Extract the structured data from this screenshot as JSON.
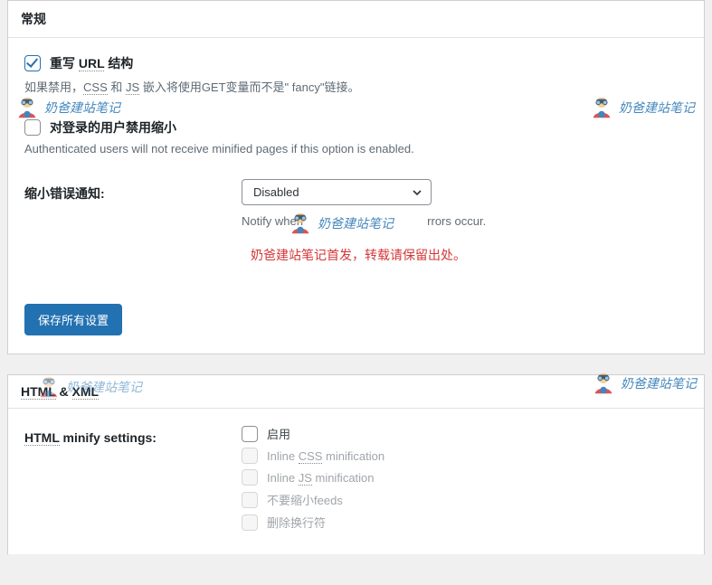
{
  "general": {
    "title": "常规",
    "rewrite": {
      "label_pre": "重写",
      "label_url": "URL",
      "label_post": "结构",
      "checked": true,
      "desc_pre": "如果禁用，",
      "desc_css": "CSS",
      "desc_mid1": "和",
      "desc_js": "JS",
      "desc_post": "嵌入将使用GET变量而不是\" fancy\"链接。"
    },
    "disable_loggedin": {
      "label": "对登录的用户禁用缩小",
      "checked": false,
      "desc": "Authenticated users will not receive minified pages if this option is enabled."
    },
    "error_notify": {
      "label": "缩小错误通知:",
      "selected": "Disabled",
      "desc_pre": "Notify when ",
      "desc_post": "rrors occur."
    },
    "attribution": "奶爸建站笔记首发，转载请保留出处。",
    "save_button": "保存所有设置"
  },
  "htmlxml": {
    "title_pre": "HTML",
    "title_mid": " & ",
    "title_post": "XML",
    "minify_label_pre": "HTML",
    "minify_label_post": " minify settings:",
    "options": {
      "enable": {
        "label": "启用",
        "enabled": true,
        "checked": false
      },
      "inline_css_pre": "Inline ",
      "inline_css_mid": "CSS",
      "inline_css_post": " minification",
      "inline_js_pre": "Inline ",
      "inline_js_mid": "JS",
      "inline_js_post": " minification",
      "no_minify_feeds": "不要缩小feeds",
      "remove_linebreaks": "删除换行符"
    }
  },
  "watermark_text": "奶爸建站笔记"
}
